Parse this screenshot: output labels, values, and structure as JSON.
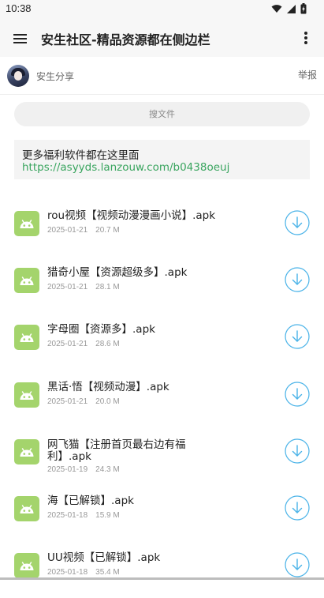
{
  "status_bar": {
    "time": "10:38"
  },
  "toolbar": {
    "title": "安生社区-精品资源都在侧边栏"
  },
  "author": {
    "name": "安生分享",
    "report_label": "举报"
  },
  "search": {
    "label": "搜文件"
  },
  "description": {
    "text": "更多福利软件都在这里面",
    "link": "https://asyyds.lanzouw.com/b0438oeuj"
  },
  "files": [
    {
      "name": "rou视频【视频动漫漫画小说】.apk",
      "date": "2025-01-21",
      "size": "20.7 M"
    },
    {
      "name": "猎奇小屋【资源超级多】.apk",
      "date": "2025-01-21",
      "size": "28.1 M"
    },
    {
      "name": "字母圈【资源多】.apk",
      "date": "2025-01-21",
      "size": "28.6 M"
    },
    {
      "name": "黑话·悟【视频动漫】.apk",
      "date": "2025-01-21",
      "size": "20.0 M"
    },
    {
      "name": "网飞猫【注册首页最右边有福利】.apk",
      "date": "2025-01-19",
      "size": "24.3 M"
    },
    {
      "name": "海【已解锁】.apk",
      "date": "2025-01-18",
      "size": "15.9 M"
    },
    {
      "name": "UU视频【已解锁】.apk",
      "date": "2025-01-18",
      "size": "35.4 M"
    }
  ],
  "colors": {
    "accent_blue": "#4ab3e8",
    "apk_green": "#a4d46c",
    "link_green": "#3aa55f"
  },
  "icons": {
    "menu": "hamburger-menu-icon",
    "more": "more-vertical-icon",
    "download": "download-circle-icon",
    "apk": "android-apk-icon",
    "wifi": "wifi-icon",
    "signal": "signal-icon",
    "battery": "battery-charging-icon"
  }
}
